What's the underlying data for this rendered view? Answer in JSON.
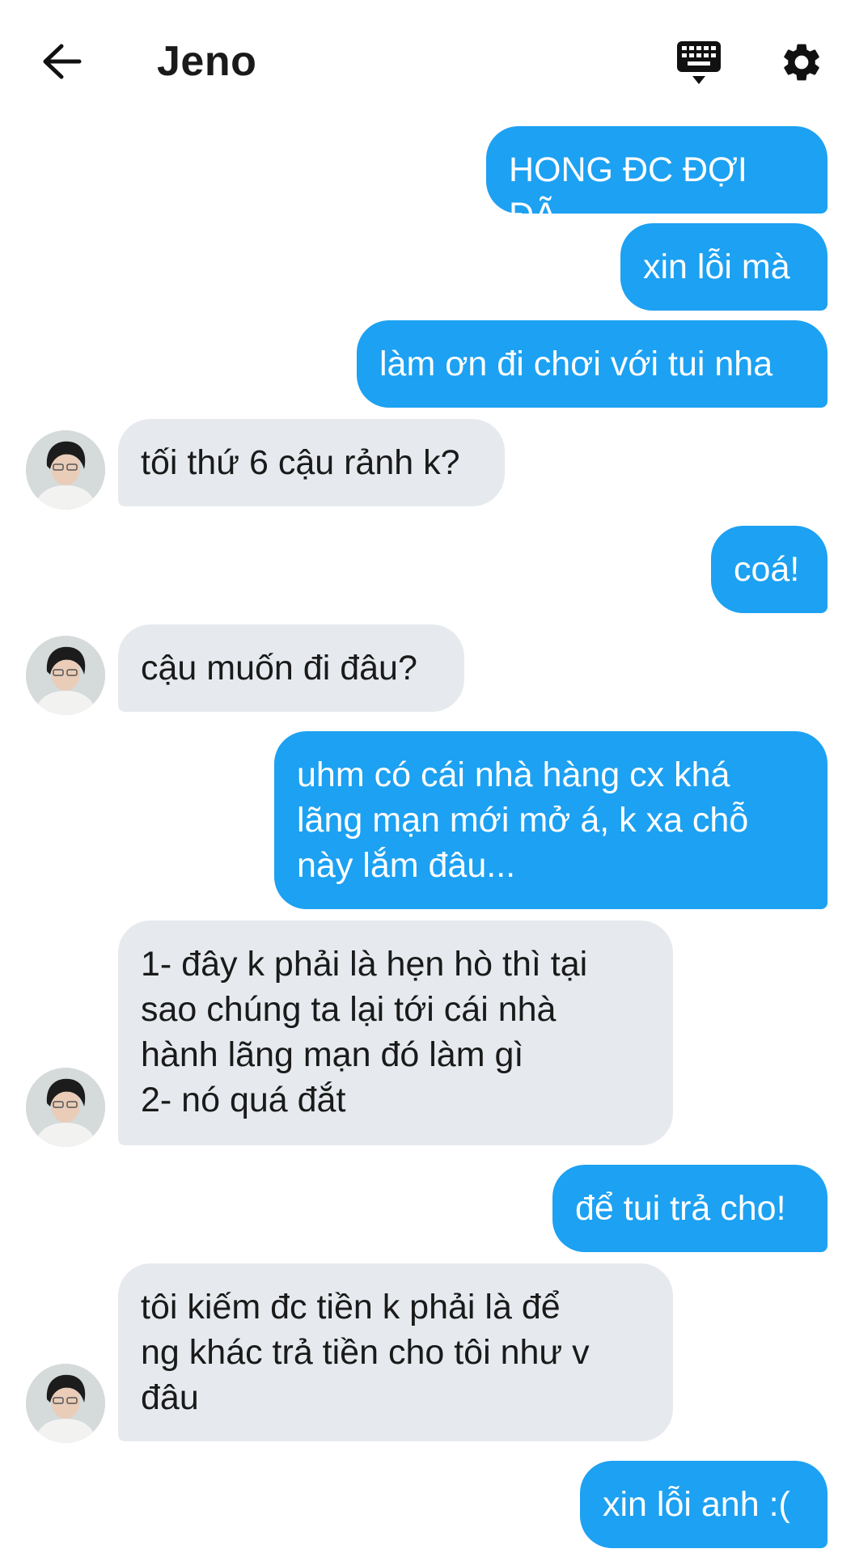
{
  "header": {
    "title": "Jeno",
    "back_icon": "arrow-left-icon",
    "keyboard_icon": "keyboard-icon",
    "settings_icon": "gear-icon"
  },
  "colors": {
    "outgoing_bubble": "#1da1f2",
    "incoming_bubble": "#e6eaee",
    "background": "#ffffff"
  },
  "messages": [
    {
      "dir": "out",
      "text": "HONG ĐC ĐỢI ĐÃ"
    },
    {
      "dir": "out",
      "text": "xin lỗi mà"
    },
    {
      "dir": "out",
      "text": "làm ơn đi chơi với tui nha"
    },
    {
      "dir": "in",
      "text": "tối thứ 6 cậu rảnh k?"
    },
    {
      "dir": "out",
      "text": "coá!"
    },
    {
      "dir": "in",
      "text": "cậu muốn đi đâu?"
    },
    {
      "dir": "out",
      "text": "uhm có cái nhà hàng cx khá\nlãng mạn mới mở á, k xa chỗ\nnày lắm đâu..."
    },
    {
      "dir": "in",
      "text": "1- đây k phải là hẹn hò thì tại\nsao chúng ta lại tới cái nhà\nhành lãng mạn đó làm gì\n2- nó quá đắt"
    },
    {
      "dir": "out",
      "text": "để tui trả cho!"
    },
    {
      "dir": "in",
      "text": "tôi kiếm đc tiền k phải là để\nng khác trả tiền cho tôi như v\nđâu"
    },
    {
      "dir": "out",
      "text": "xin lỗi anh :("
    }
  ]
}
